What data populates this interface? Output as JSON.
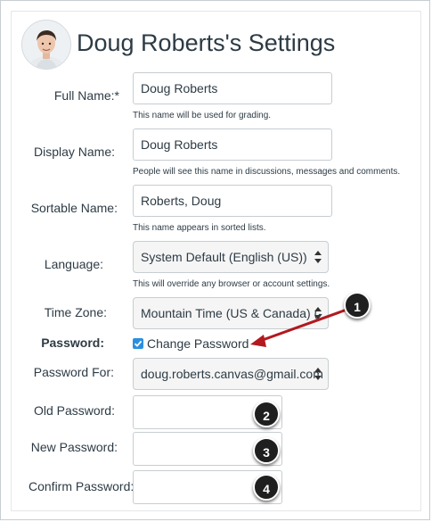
{
  "header": {
    "title": "Doug Roberts's Settings"
  },
  "fields": {
    "full_name": {
      "label": "Full Name:*",
      "value": "Doug Roberts",
      "hint": "This name will be used for grading."
    },
    "display_name": {
      "label": "Display Name:",
      "value": "Doug Roberts",
      "hint": "People will see this name in discussions, messages and comments."
    },
    "sortable_name": {
      "label": "Sortable Name:",
      "value": "Roberts, Doug",
      "hint": "This name appears in sorted lists."
    },
    "language": {
      "label": "Language:",
      "value": "System Default (English (US))",
      "hint": "This will override any browser or account settings."
    },
    "time_zone": {
      "label": "Time Zone:",
      "value": "Mountain Time (US & Canada) (-"
    },
    "password": {
      "label": "Password:",
      "checkbox_label": "Change Password",
      "checked": true
    },
    "password_for": {
      "label": "Password For:",
      "value": "doug.roberts.canvas@gmail.com"
    },
    "old_password": {
      "label": "Old Password:"
    },
    "new_password": {
      "label": "New Password:"
    },
    "confirm_password": {
      "label": "Confirm Password:"
    }
  },
  "callouts": [
    "1",
    "2",
    "3",
    "4"
  ],
  "colors": {
    "accent": "#2b8fe0",
    "arrow": "#b3181f",
    "badge": "#1f1f1f"
  }
}
